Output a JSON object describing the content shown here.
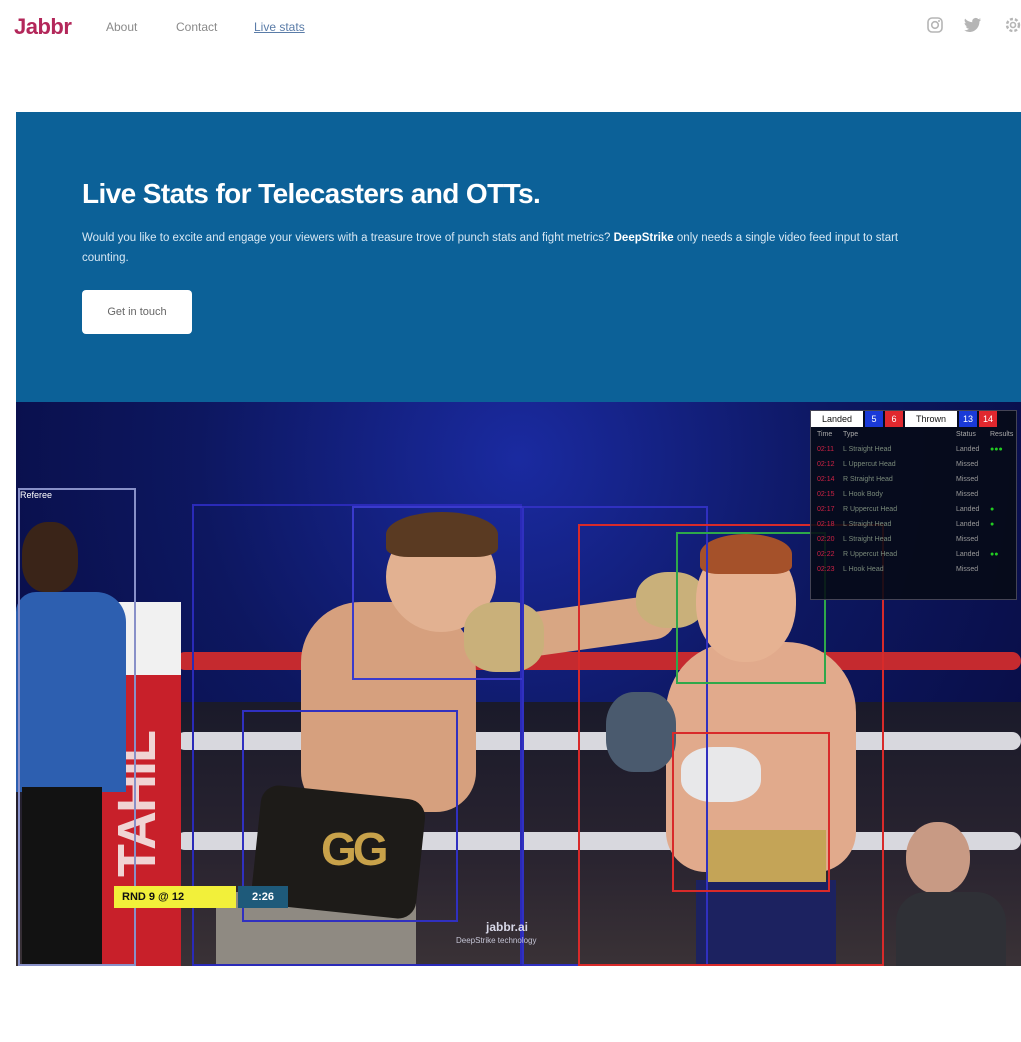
{
  "nav": {
    "brand": "Jabbr",
    "links": [
      {
        "label": "About"
      },
      {
        "label": "Contact"
      },
      {
        "label": "Live stats"
      }
    ],
    "social_icons": [
      "instagram-icon",
      "twitter-icon",
      "settings-icon"
    ]
  },
  "hero": {
    "title": "Live Stats for Telecasters and OTTs.",
    "text_before": "Would you like to excite and engage your viewers with a treasure trove of punch stats and fight metrics? ",
    "text_bold": "DeepStrike",
    "text_after": " only needs a single video feed input to start counting.",
    "cta_label": "Get in touch",
    "background": "#0c6198"
  },
  "video": {
    "ref_label": "Referee",
    "post_text": "TAHIL",
    "shorts_logo": "GG",
    "score_left": "RND 9 @ 12",
    "score_right": "2:26",
    "watermark": "jabbr.ai",
    "watermark_sub": "DeepStrike technology",
    "stats": {
      "header": [
        {
          "label": "Landed",
          "bg": "#ffffff",
          "fg": "#111111"
        },
        {
          "label": "5",
          "bg": "#1a3ad8",
          "fg": "#ffffff"
        },
        {
          "label": "6",
          "bg": "#e0282e",
          "fg": "#ffffff"
        },
        {
          "label": "Thrown",
          "bg": "#ffffff",
          "fg": "#111111"
        },
        {
          "label": "13",
          "bg": "#1a3ad8",
          "fg": "#ffffff"
        },
        {
          "label": "14",
          "bg": "#e0282e",
          "fg": "#ffffff"
        }
      ],
      "columns": {
        "time": "Time",
        "desc": "Type",
        "result": "Status",
        "marks": "Results"
      },
      "rows": [
        {
          "time": "02:11",
          "desc": "L Straight Head",
          "result": "Landed",
          "marks": "●●●"
        },
        {
          "time": "02:12",
          "desc": "L Uppercut Head",
          "result": "Missed",
          "marks": ""
        },
        {
          "time": "02:14",
          "desc": "R Straight Head",
          "result": "Missed",
          "marks": ""
        },
        {
          "time": "02:15",
          "desc": "L Hook Body",
          "result": "Missed",
          "marks": ""
        },
        {
          "time": "02:17",
          "desc": "R Uppercut Head",
          "result": "Landed",
          "marks": "●"
        },
        {
          "time": "02:18",
          "desc": "L Straight Head",
          "result": "Landed",
          "marks": "●"
        },
        {
          "time": "02:20",
          "desc": "L Straight Head",
          "result": "Missed",
          "marks": ""
        },
        {
          "time": "02:22",
          "desc": "R Uppercut Head",
          "result": "Landed",
          "marks": "●●"
        },
        {
          "time": "02:23",
          "desc": "L Hook Head",
          "result": "Missed",
          "marks": ""
        }
      ]
    }
  }
}
